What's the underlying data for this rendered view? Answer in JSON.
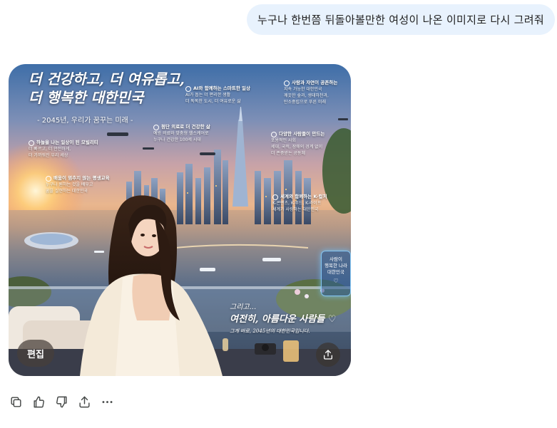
{
  "user_message": {
    "text": "누구나 한번쯤 뒤돌아볼만한 여성이 나온 이미지로 다시 그려줘"
  },
  "generated_image": {
    "title": "더 건강하고, 더 여유롭고,\n더 행복한 대한민국",
    "subtitle": "- 2045년, 우리가 꿈꾸는 미래 -",
    "info_boxes": [
      {
        "heading": "AI와 함께하는 스마트한 일상",
        "lines": [
          "AI가 돕는 더 편리한 생활",
          "더 똑똑한 도시, 더 여유로운 삶"
        ]
      },
      {
        "heading": "사람과 자연이 공존하는",
        "lines": [
          "지속 가능한 대한민국",
          "깨끗한 숲과, 생태하천과,",
          "탄소중립으로 푸른 미래"
        ]
      },
      {
        "heading": "하늘을 나는 일상이 된 모빌리티",
        "lines": [
          "더 빠르고, 더 안전하게,",
          "더 가까워진 우리 세상"
        ]
      },
      {
        "heading": "첨단 의료로 더 건강한 삶",
        "lines": [
          "예방 의료와 맞춤형 헬스케어로",
          "누구나 건강한 100세 시대"
        ]
      },
      {
        "heading": "다양한 사람들이 만드는",
        "lines": [
          "포용적인 사회",
          "세대, 국적, 장애의 경계 없이",
          "더 존중받는 공동체"
        ]
      },
      {
        "heading": "배움이 멈추지 않는 평생교육",
        "lines": [
          "누구나 원하는 것을 배우고",
          "꿈을 실현하는 대한민국"
        ]
      },
      {
        "heading": "세계와 함께하는 K-컬처",
        "lines": [
          "K-콘텐츠, K-푸드, K-라이프",
          "세계가 사랑하는 대한민국"
        ]
      }
    ],
    "badge": "사람이\n행복한 나라\n대한민국",
    "closing_line1": "그리고...",
    "closing_line2": "여전히, 아름다운 사람들 ♡",
    "closing_line3": "그게 바로, 2045년의 대한민국입니다.",
    "edit_label": "편집",
    "share_icon": "share-upload-icon"
  },
  "actions": [
    {
      "name": "copy",
      "icon": "copy-icon"
    },
    {
      "name": "thumbs-up",
      "icon": "thumbs-up-icon"
    },
    {
      "name": "thumbs-down",
      "icon": "thumbs-down-icon"
    },
    {
      "name": "share",
      "icon": "share-icon"
    },
    {
      "name": "more",
      "icon": "more-icon"
    }
  ],
  "colors": {
    "user_bubble": "#e8f2fd",
    "text": "#1f1f1f",
    "icon": "#444746"
  }
}
